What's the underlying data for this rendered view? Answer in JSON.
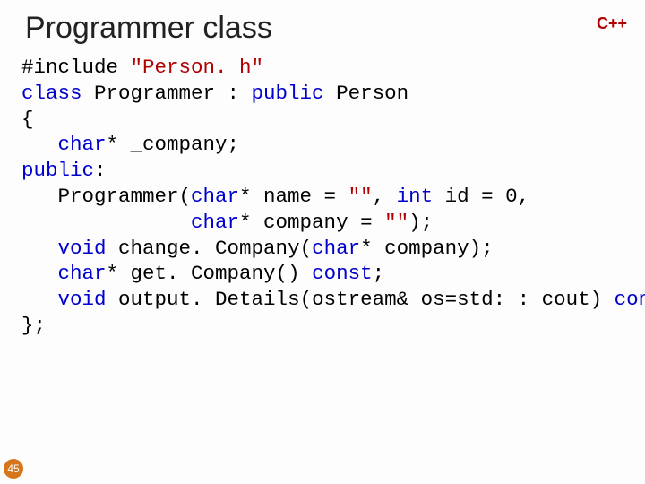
{
  "slide": {
    "title": "Programmer class",
    "badge": "C++",
    "page_number": "45"
  },
  "code": {
    "l1_a": "#include ",
    "l1_b": "\"Person. h\"",
    "l2_a": "class",
    "l2_b": " Programmer : ",
    "l2_c": "public",
    "l2_d": " Person",
    "l3": "{",
    "l4_a": "   ",
    "l4_b": "char",
    "l4_c": "* _company;",
    "l5_a": "public",
    "l5_b": ":",
    "l6_a": "   Programmer(",
    "l6_b": "char",
    "l6_c": "* name = ",
    "l6_d": "\"\"",
    "l6_e": ", ",
    "l6_f": "int",
    "l6_g": " id = 0,",
    "l7_a": "              ",
    "l7_b": "char",
    "l7_c": "* company = ",
    "l7_d": "\"\"",
    "l7_e": ");",
    "l8_a": "   ",
    "l8_b": "void",
    "l8_c": " change. Company(",
    "l8_d": "char",
    "l8_e": "* company);",
    "l9_a": "   ",
    "l9_b": "char",
    "l9_c": "* get. Company() ",
    "l9_d": "const",
    "l9_e": ";",
    "l10_a": "   ",
    "l10_b": "void",
    "l10_c": " output. Details(ostream& os=std: : cout) ",
    "l10_d": "const",
    "l10_e": ";",
    "l11": "};"
  }
}
